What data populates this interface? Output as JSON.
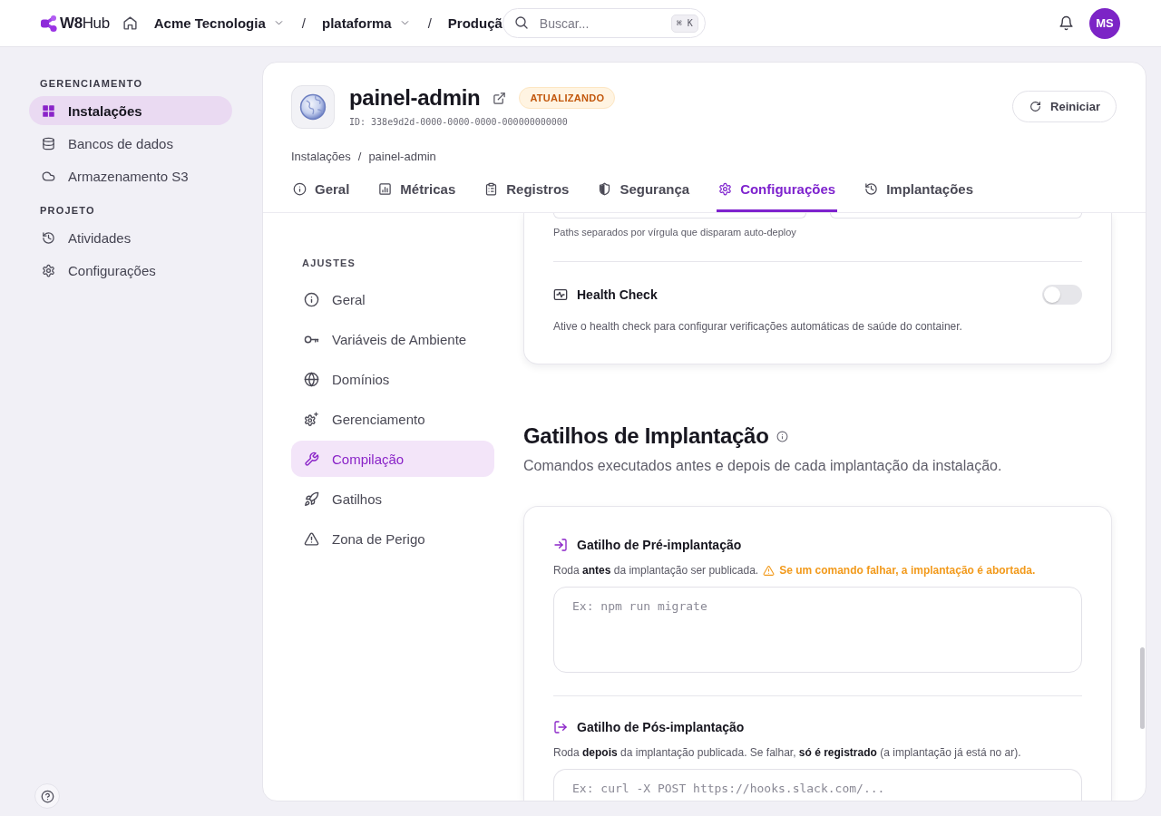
{
  "topbar": {
    "logo": "**W8**Hub",
    "breadcrumbs": [
      {
        "label": "Acme Tecnologia",
        "dropdown": true
      },
      {
        "separator": "/",
        "label": "plataforma",
        "dropdown": true
      },
      {
        "separator": "/",
        "label": "Produçã",
        "dropdown": false
      }
    ],
    "search": {
      "placeholder": "Buscar...",
      "shortcut": "⌘ K"
    },
    "avatar": {
      "initials": "MS"
    }
  },
  "sidebar": {
    "sections": [
      {
        "label": "GERENCIAMENTO",
        "items": [
          {
            "label": "Instalações",
            "selected": true
          },
          {
            "label": "Bancos de dados",
            "selected": false
          },
          {
            "label": "Armazenamento S3",
            "selected": false
          }
        ]
      },
      {
        "label": "PROJETO",
        "items": [
          {
            "label": "Atividades",
            "selected": false
          },
          {
            "label": "Configurações",
            "selected": false
          }
        ]
      }
    ]
  },
  "installation": {
    "name": "painel-admin",
    "status": "ATUALIZANDO",
    "id": "ID: 338e9d2d-0000-0000-0000-000000000000",
    "restart_button": "Reiniciar"
  },
  "breadcrumb": [
    {
      "label": "Instalações"
    },
    {
      "separator": "/",
      "label": "painel-admin"
    }
  ],
  "tabs": [
    {
      "label": "Geral",
      "selected": false
    },
    {
      "label": "Métricas",
      "selected": false
    },
    {
      "label": "Registros",
      "selected": false
    },
    {
      "label": "Segurança",
      "selected": false
    },
    {
      "label": "Configurações",
      "selected": true
    },
    {
      "label": "Implantações",
      "selected": false
    }
  ],
  "settings_nav": {
    "title": "AJUSTES",
    "items": [
      {
        "label": "Geral",
        "selected": false
      },
      {
        "label": "Variáveis de Ambiente",
        "selected": false
      },
      {
        "label": "Domínios",
        "selected": false
      },
      {
        "label": "Gerenciamento",
        "selected": false
      },
      {
        "label": "Compilação",
        "selected": true
      },
      {
        "label": "Gatilhos",
        "selected": false
      },
      {
        "label": "Zona de Perigo",
        "selected": false
      }
    ]
  },
  "settings_card": {
    "paths_hint": "Paths separados por vírgula que disparam auto-deploy",
    "health_check": {
      "title": "Health Check",
      "on": false,
      "description": "Ative o health check para configurar verificações automáticas de saúde do container."
    }
  },
  "deploy_triggers": {
    "title": "Gatilhos de Implantação",
    "subtitle": "Comandos executados antes e depois de cada implantação da instalação.",
    "triggers": [
      {
        "kind": "pre",
        "title": "Gatilho de Pré-implantação",
        "description": "Roda **antes** da implantação ser publicada.",
        "warning": "Se um comando falhar, a implantação é abortada.",
        "placeholder": "Ex: npm run migrate"
      },
      {
        "kind": "post",
        "title": "Gatilho de Pós-implantação",
        "description": "Roda **depois** da implantação publicada. Se falhar, **só é registrado** (a implantação já está no ar).",
        "placeholder": "Ex: curl -X POST https://hooks.slack.com/..."
      }
    ]
  }
}
